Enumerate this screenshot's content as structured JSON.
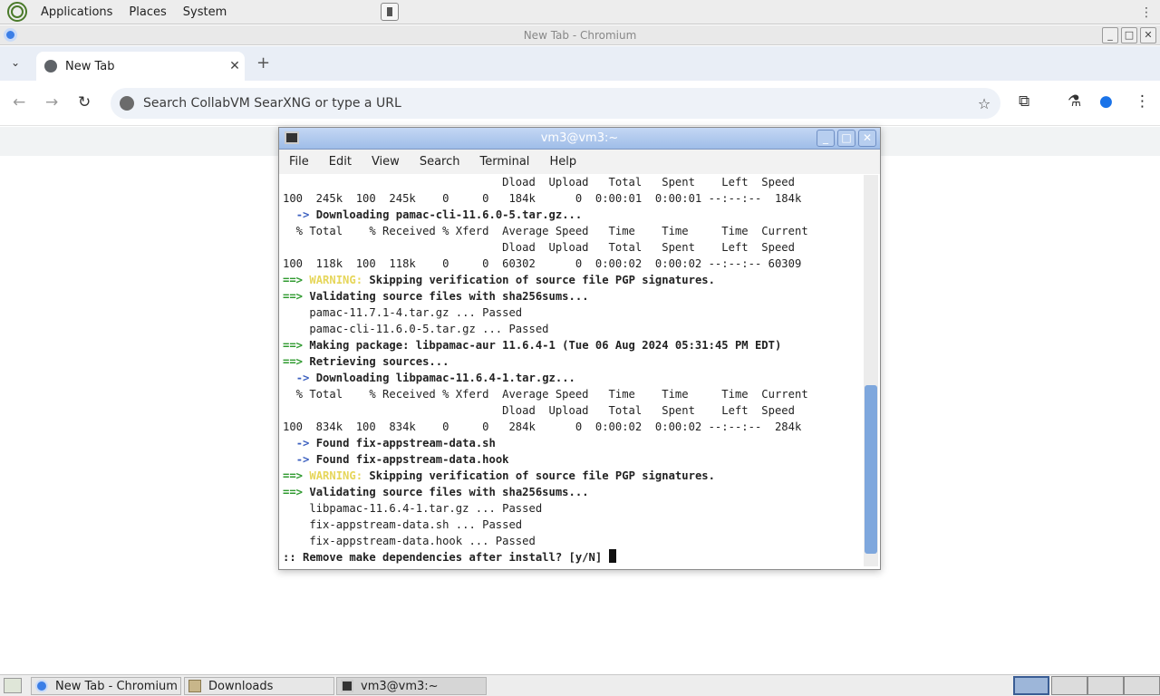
{
  "top_panel": {
    "menus": [
      "Applications",
      "Places",
      "System"
    ]
  },
  "chromium": {
    "window_title": "New Tab - Chromium",
    "tabs": [
      {
        "label": "New Tab"
      }
    ],
    "omnibox_placeholder": "Search CollabVM SearXNG or type a URL"
  },
  "terminal": {
    "window_title": "vm3@vm3:~",
    "menu": [
      "File",
      "Edit",
      "View",
      "Search",
      "Terminal",
      "Help"
    ],
    "lines": [
      "                                 Dload  Upload   Total   Spent    Left  Speed",
      "100  245k  100  245k    0     0   184k      0  0:00:01  0:00:01 --:--:--  184k",
      "  -> Downloading pamac-cli-11.6.0-5.tar.gz...",
      "  % Total    % Received % Xferd  Average Speed   Time    Time     Time  Current",
      "                                 Dload  Upload   Total   Spent    Left  Speed",
      "100  118k  100  118k    0     0  60302      0  0:00:02  0:00:02 --:--:-- 60309",
      "==> WARNING: Skipping verification of source file PGP signatures.",
      "==> Validating source files with sha256sums...",
      "    pamac-11.7.1-4.tar.gz ... Passed",
      "    pamac-cli-11.6.0-5.tar.gz ... Passed",
      "==> Making package: libpamac-aur 11.6.4-1 (Tue 06 Aug 2024 05:31:45 PM EDT)",
      "==> Retrieving sources...",
      "  -> Downloading libpamac-11.6.4-1.tar.gz...",
      "  % Total    % Received % Xferd  Average Speed   Time    Time     Time  Current",
      "                                 Dload  Upload   Total   Spent    Left  Speed",
      "100  834k  100  834k    0     0   284k      0  0:00:02  0:00:02 --:--:--  284k",
      "  -> Found fix-appstream-data.sh",
      "  -> Found fix-appstream-data.hook",
      "==> WARNING: Skipping verification of source file PGP signatures.",
      "==> Validating source files with sha256sums...",
      "    libpamac-11.6.4-1.tar.gz ... Passed",
      "    fix-appstream-data.sh ... Passed",
      "    fix-appstream-data.hook ... Passed",
      ":: Remove make dependencies after install? [y/N] "
    ],
    "scroll_fraction": 1.0
  },
  "taskbar": {
    "tasks": [
      {
        "label": "New Tab - Chromium",
        "icon": "chromium-icon"
      },
      {
        "label": "Downloads",
        "icon": "folder-icon"
      },
      {
        "label": "vm3@vm3:~",
        "icon": "terminal-icon"
      }
    ]
  }
}
